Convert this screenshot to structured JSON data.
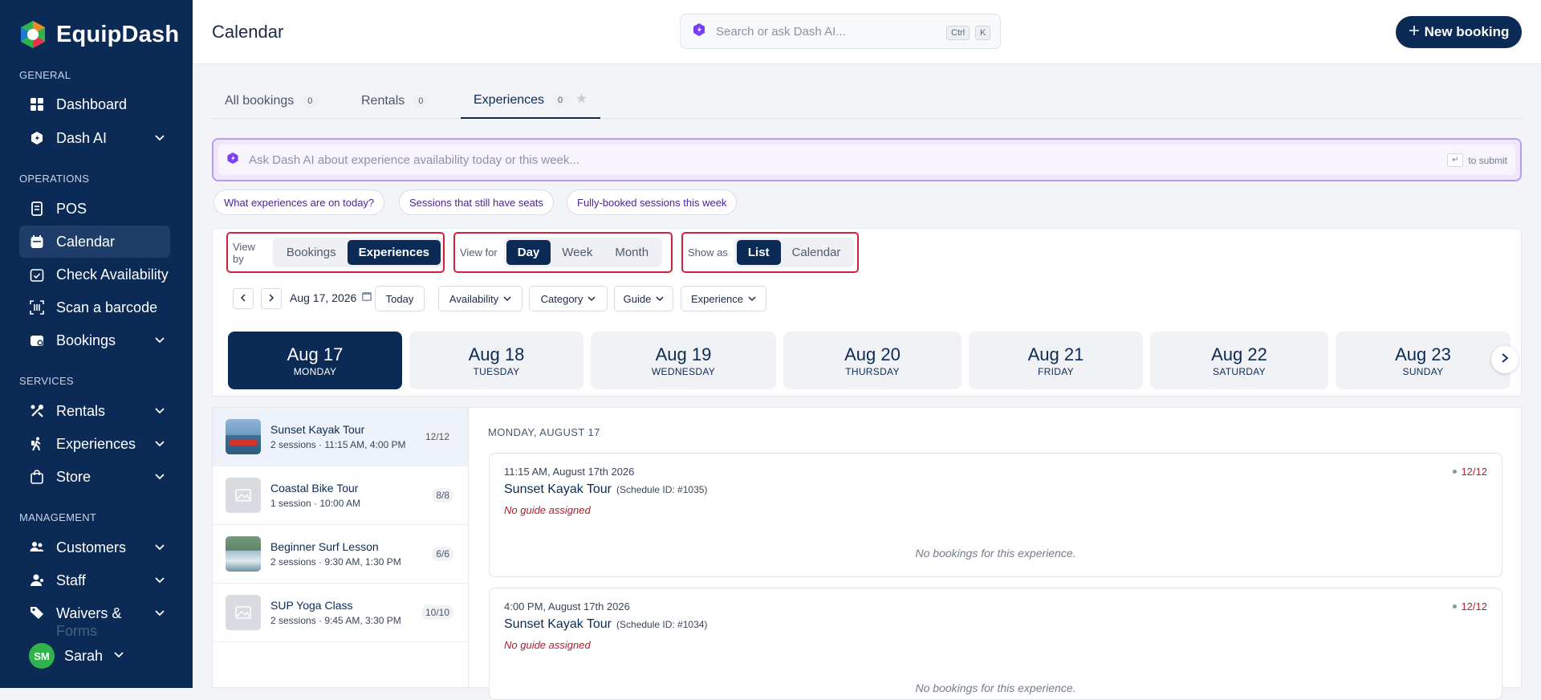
{
  "app": {
    "name": "EquipDash"
  },
  "sidebar": {
    "sections": {
      "general": "GENERAL",
      "operations": "OPERATIONS",
      "services": "SERVICES",
      "management": "MANAGEMENT"
    },
    "items": {
      "dashboard": "Dashboard",
      "dash_ai": "Dash AI",
      "pos": "POS",
      "calendar": "Calendar",
      "check_availability": "Check Availability",
      "scan_barcode": "Scan a barcode",
      "bookings": "Bookings",
      "rentals": "Rentals",
      "experiences": "Experiences",
      "store": "Store",
      "customers": "Customers",
      "staff": "Staff",
      "waivers": "Waivers &",
      "waivers_cont": "Forms"
    },
    "user": {
      "initials": "SM",
      "name": "Sarah"
    }
  },
  "header": {
    "title": "Calendar",
    "search_placeholder": "Search or ask Dash AI...",
    "kbd_ctrl": "Ctrl",
    "kbd_k": "K",
    "new_booking": "New booking"
  },
  "tabs": [
    {
      "label": "All bookings",
      "count": "0"
    },
    {
      "label": "Rentals",
      "count": "0"
    },
    {
      "label": "Experiences",
      "count": "0"
    }
  ],
  "ai": {
    "placeholder": "Ask Dash AI about experience availability today or this week...",
    "submit_hint": "to submit",
    "enter_key": "↵"
  },
  "chips": [
    "What experiences are on today?",
    "Sessions that still have seats",
    "Fully-booked sessions this week"
  ],
  "controls": {
    "view_by": {
      "label": "View by",
      "options": [
        "Bookings",
        "Experiences"
      ],
      "selected": "Experiences"
    },
    "view_for": {
      "label": "View for",
      "options": [
        "Day",
        "Week",
        "Month"
      ],
      "selected": "Day"
    },
    "show_as": {
      "label": "Show as",
      "options": [
        "List",
        "Calendar"
      ],
      "selected": "List"
    },
    "date": "Aug 17, 2026",
    "today": "Today",
    "filters": [
      "Availability",
      "Category",
      "Guide",
      "Experience"
    ]
  },
  "days": [
    {
      "date": "Aug 17",
      "weekday": "MONDAY",
      "selected": true
    },
    {
      "date": "Aug 18",
      "weekday": "TUESDAY"
    },
    {
      "date": "Aug 19",
      "weekday": "WEDNESDAY"
    },
    {
      "date": "Aug 20",
      "weekday": "THURSDAY"
    },
    {
      "date": "Aug 21",
      "weekday": "FRIDAY"
    },
    {
      "date": "Aug 22",
      "weekday": "SATURDAY"
    },
    {
      "date": "Aug 23",
      "weekday": "SUNDAY"
    }
  ],
  "experiences": [
    {
      "name": "Sunset Kayak Tour",
      "sub": "2 sessions · 11:15 AM, 4:00 PM",
      "badge": "12/12"
    },
    {
      "name": "Coastal Bike Tour",
      "sub": "1 session · 10:00 AM",
      "badge": "8/8"
    },
    {
      "name": "Beginner Surf Lesson",
      "sub": "2 sessions · 9:30 AM, 1:30 PM",
      "badge": "6/6"
    },
    {
      "name": "SUP Yoga Class",
      "sub": "2 sessions · 9:45 AM, 3:30 PM",
      "badge": "10/10"
    }
  ],
  "detail": {
    "day_heading": "MONDAY, AUGUST 17",
    "sessions": [
      {
        "time": "11:15 AM, August 17th 2026",
        "name": "Sunset Kayak Tour",
        "schedule": "(Schedule ID: #1035)",
        "guide": "No guide assigned",
        "capacity": "12/12",
        "empty": "No bookings for this experience."
      },
      {
        "time": "4:00 PM, August 17th 2026",
        "name": "Sunset Kayak Tour",
        "schedule": "(Schedule ID: #1034)",
        "guide": "No guide assigned",
        "capacity": "12/12",
        "empty": "No bookings for this experience."
      }
    ]
  }
}
